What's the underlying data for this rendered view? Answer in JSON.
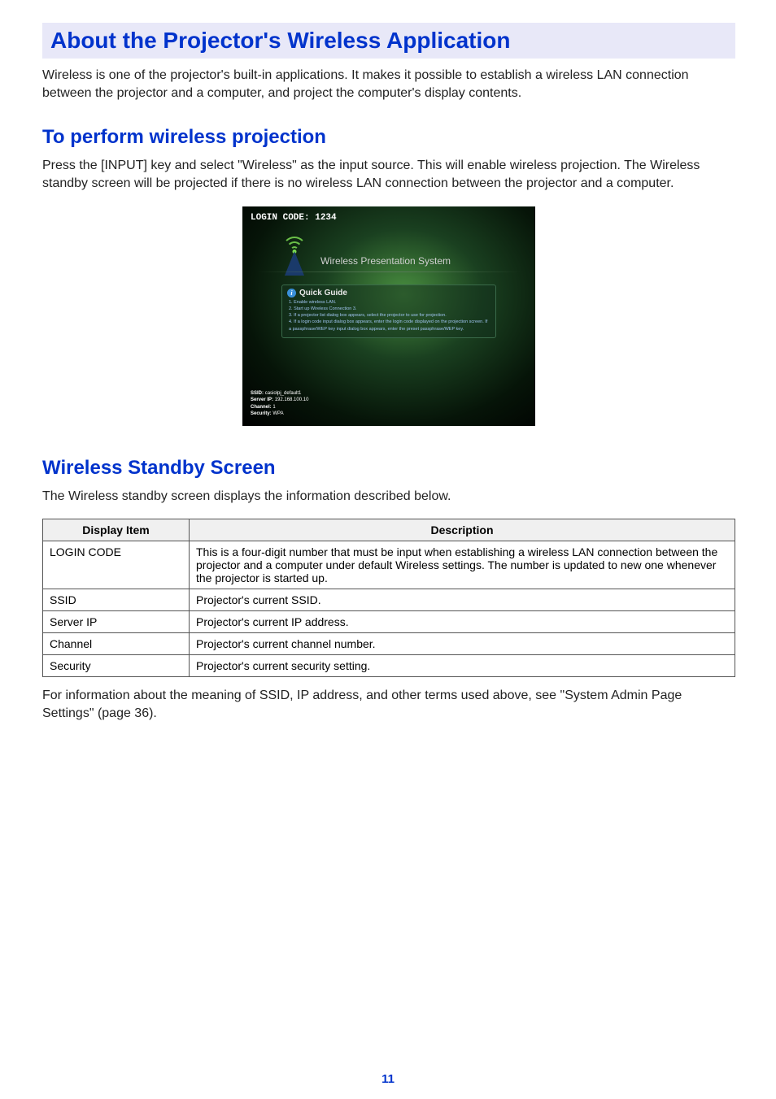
{
  "title": "About the Projector's Wireless Application",
  "intro": "Wireless is one of the projector's built-in applications. It makes it possible to establish a wireless LAN connection between the projector and a computer, and project the computer's display contents.",
  "section1": {
    "heading": "To perform wireless projection",
    "body": "Press the [INPUT] key and select \"Wireless\" as the input source. This will enable wireless projection. The Wireless standby screen will be projected if there is no wireless LAN connection between the projector and a computer."
  },
  "screenshot": {
    "login_label": "LOGIN CODE: 1234",
    "system_title": "Wireless Presentation System",
    "quick_guide_title": "Quick Guide",
    "steps": [
      "1. Enable wireless LAN.",
      "2. Start up Wireless Connection 3.",
      "3. If a projector list dialog box appears, select the projector to use for projection.",
      "4. If a login code input dialog box appears, enter the login code displayed on the projection screen. If a passphrase/WEP key input dialog box appears, enter the preset passphrase/WEP key."
    ],
    "ssid_label": "SSID:",
    "ssid_value": "casiolpj_default1",
    "server_label": "Server IP:",
    "server_value": "192.168.100.10",
    "channel_label": "Channel:",
    "channel_value": "1",
    "security_label": "Security:",
    "security_value": "WPA"
  },
  "section2": {
    "heading": "Wireless Standby Screen",
    "body": "The Wireless standby screen displays the information described below.",
    "headers": {
      "item": "Display Item",
      "desc": "Description"
    },
    "rows": [
      {
        "item": "LOGIN CODE",
        "desc": "This is a four-digit number that must be input when establishing a wireless LAN connection between the projector and a computer under default Wireless settings. The number is updated to new one whenever the projector is started up."
      },
      {
        "item": "SSID",
        "desc": "Projector's current SSID."
      },
      {
        "item": "Server IP",
        "desc": "Projector's current IP address."
      },
      {
        "item": "Channel",
        "desc": "Projector's current channel number."
      },
      {
        "item": "Security",
        "desc": "Projector's current security setting."
      }
    ],
    "after": "For information about the meaning of SSID, IP address, and other terms used above, see \"System Admin Page Settings\" (page 36)."
  },
  "page_number": "11"
}
